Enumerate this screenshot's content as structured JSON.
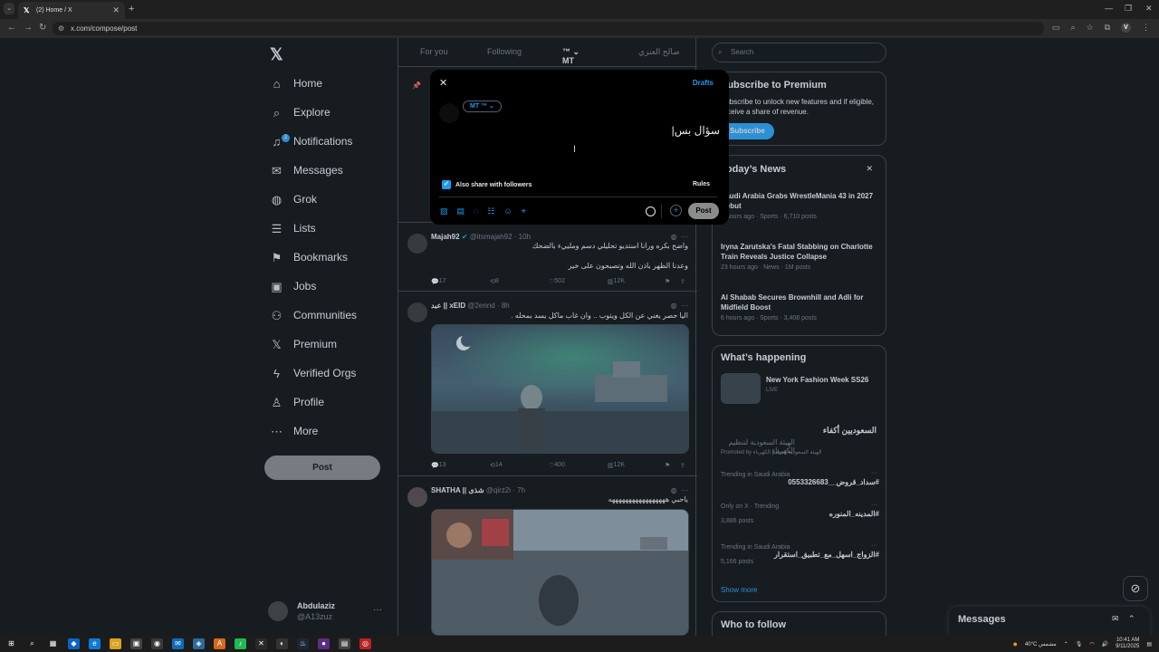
{
  "browser": {
    "tab_title": "(2) Home / X",
    "url": "x.com/compose/post"
  },
  "nav": {
    "items": [
      "Home",
      "Explore",
      "Notifications",
      "Messages",
      "Grok",
      "Lists",
      "Bookmarks",
      "Jobs",
      "Communities",
      "Premium",
      "Verified Orgs",
      "Profile",
      "More"
    ],
    "notif_badge": "2",
    "post_label": "Post",
    "account_name": "Abdulaziz",
    "account_handle": "@A13zuz"
  },
  "tabs": [
    "For you",
    "Following",
    "MT",
    "صالح العنزي"
  ],
  "modal": {
    "drafts": "Drafts",
    "audience": "MT",
    "text": "سؤال بس|",
    "share_label": "Also share with followers",
    "rules": "Rules",
    "post": "Post"
  },
  "tweets": [
    {
      "name": "Majah92",
      "meta": "@itsmajah92 · 10h",
      "line1": "واضح بكره ورانا استديو تحليلي دسم وملييء بالضحك",
      "line2": "وعدنا الظهر باذن الله وتصبحون على خير",
      "replies": "17",
      "reposts": "8",
      "likes": "502",
      "views": "12K"
    },
    {
      "name": "عبد || xEID",
      "meta": "@2ennd · 8h",
      "line1": "اليا حصر يغني عن الكل ويتوب .. وان غاب ماكل يسد بمحله .",
      "replies": "13",
      "reposts": "14",
      "likes": "400",
      "views": "12K"
    },
    {
      "name": "SHATHA || شذى",
      "meta": "@qirz2i · 7h",
      "line1": "ياحبي هههههههههههههههههه"
    }
  ],
  "right": {
    "search_placeholder": "Search",
    "premium_title": "Subscribe to Premium",
    "premium_text": "Subscribe to unlock new features and if eligible, receive a share of revenue.",
    "premium_btn": "Subscribe",
    "news_title": "Today’s News",
    "news": [
      {
        "title": "Saudi Arabia Grabs WrestleMania 43 in 2027 Debut",
        "meta": "6 hours ago · Sports · 6,710 posts"
      },
      {
        "title": "Iryna Zarutska's Fatal Stabbing on Charlotte Train Reveals Justice Collapse",
        "meta": "23 hours ago · News · 1M posts"
      },
      {
        "title": "Al Shabab Secures Brownhill and Adli for Midfield Boost",
        "meta": "6 hours ago · Sports · 3,408 posts"
      }
    ],
    "happening_title": "What’s happening",
    "event_title": "New York Fashion Week SS26",
    "event_live": "LIVE",
    "promo_title": "السعوديين أكفاء",
    "promo_sub": "الهيئة السعودية لتنظيم الكهرباء",
    "promo_by": "Promoted by الهيئة السعودية لتنظيم الكهرباء",
    "trends": [
      {
        "ctx": "Trending in Saudi Arabia",
        "name": "#سداد_قروض__0553326683",
        "count": ""
      },
      {
        "ctx": "Only on X · Trending",
        "name": "#المدينه_المنوره",
        "count": "3,886 posts"
      },
      {
        "ctx": "Trending in Saudi Arabia",
        "name": "#الزواج_اسهل_مع_تطبيق_استقرار",
        "count": "5,166 posts"
      }
    ],
    "show_more": "Show more",
    "who_to_follow": "Who to follow",
    "messages": "Messages"
  },
  "taskbar": {
    "weather": "40°C  مشمس",
    "time": "10:41 AM",
    "date": "9/11/2025"
  }
}
